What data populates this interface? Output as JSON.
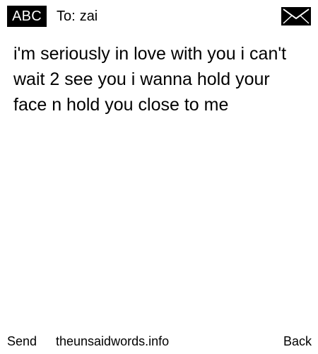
{
  "header": {
    "mode_label": "ABC",
    "to_label": "To:",
    "recipient": "zai",
    "envelope_icon": "envelope-icon"
  },
  "message": {
    "text": "i'm seriously in love with you i can't wait 2 see you i wanna hold your face n hold you close to me"
  },
  "footer": {
    "left_softkey": "Send",
    "center_text": "theunsaidwords.info",
    "right_softkey": "Back"
  },
  "colors": {
    "background": "#ffffff",
    "text": "#000000",
    "badge_background": "#000000",
    "badge_text": "#ffffff"
  }
}
